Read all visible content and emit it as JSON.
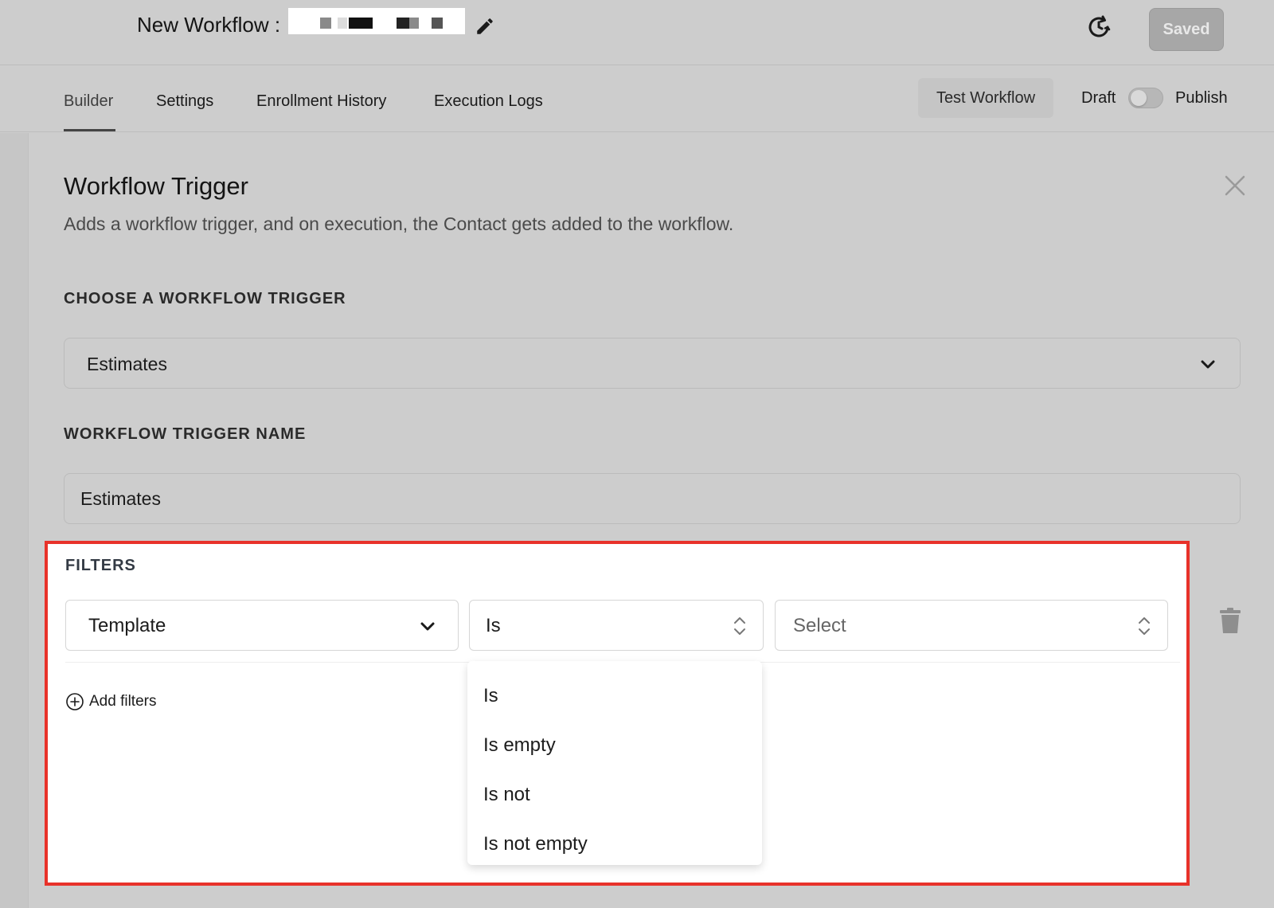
{
  "header": {
    "title_prefix": "New Workflow :",
    "save_status": "Saved"
  },
  "tabs": [
    {
      "label": "Builder"
    },
    {
      "label": "Settings"
    },
    {
      "label": "Enrollment History"
    },
    {
      "label": "Execution Logs"
    }
  ],
  "actions": {
    "test_label": "Test Workflow",
    "draft_label": "Draft",
    "publish_label": "Publish",
    "published": false
  },
  "panel": {
    "title": "Workflow Trigger",
    "description": "Adds a workflow trigger, and on execution, the Contact gets added to the workflow.",
    "choose_label": "CHOOSE A WORKFLOW TRIGGER",
    "trigger_value": "Estimates",
    "name_label": "WORKFLOW TRIGGER NAME",
    "name_value": "Estimates"
  },
  "filters": {
    "label": "FILTERS",
    "field_value": "Template",
    "operator_value": "Is",
    "value_placeholder": "Select",
    "add_label": "Add filters",
    "operator_options": [
      "Is",
      "Is empty",
      "Is not",
      "Is not empty"
    ]
  },
  "colors": {
    "highlight": "#e8322a",
    "overlay_bg": "#cdcdcd"
  }
}
